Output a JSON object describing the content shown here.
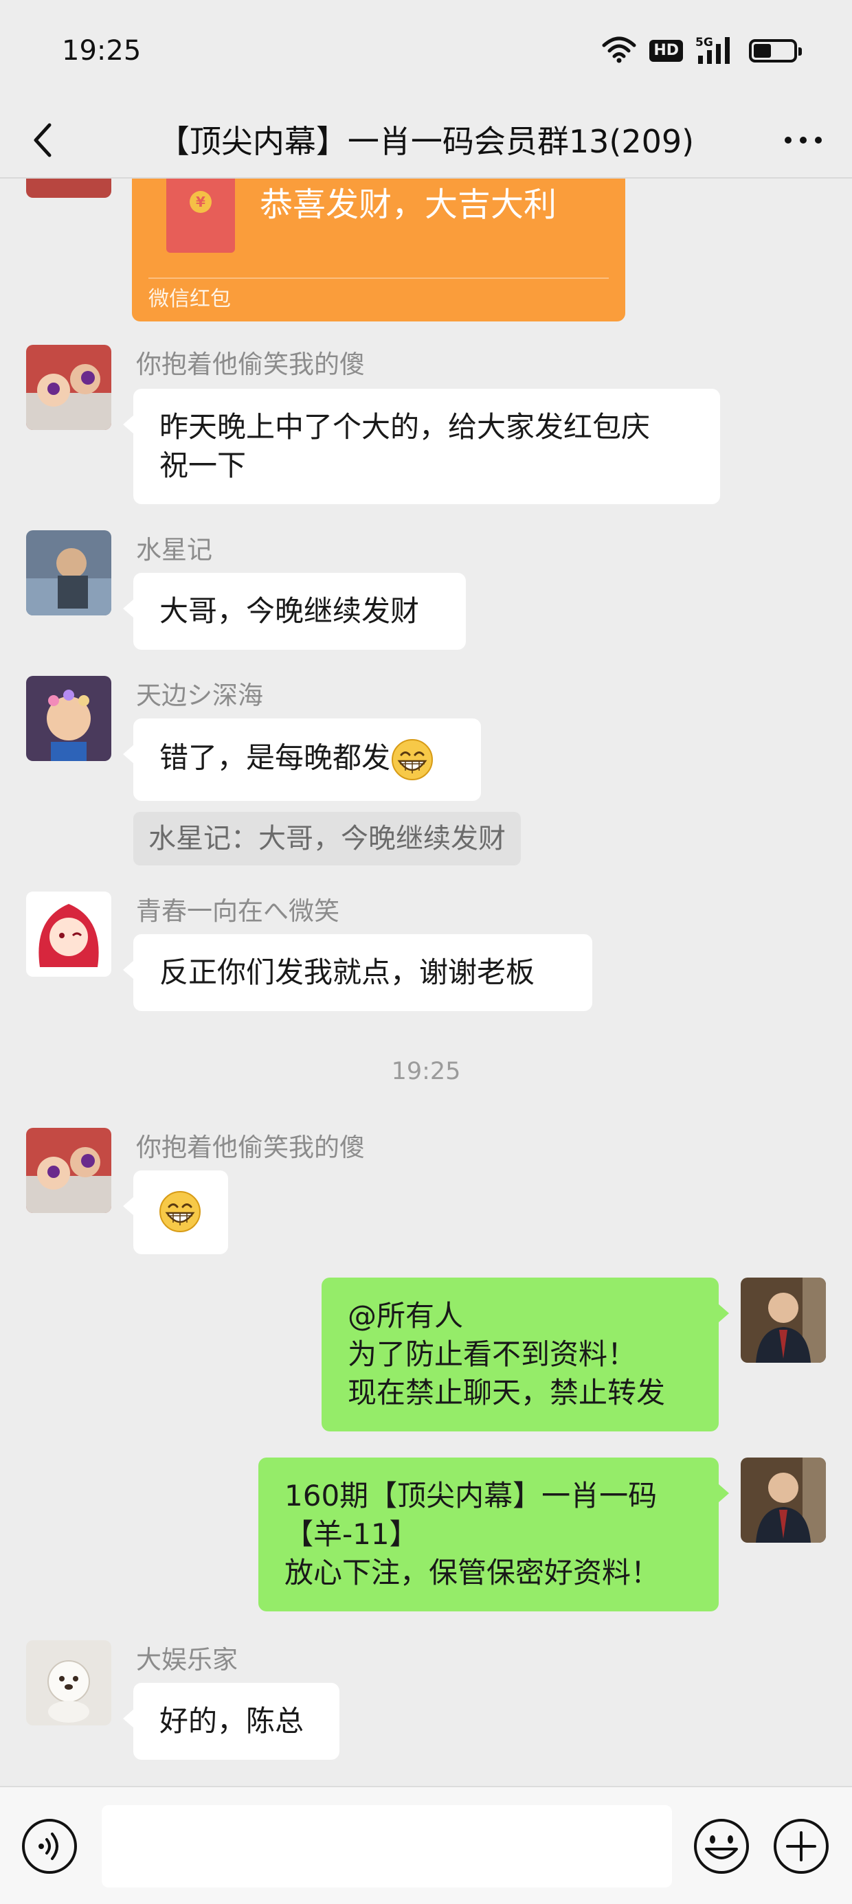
{
  "status_bar": {
    "time": "19:25",
    "hd_badge": "HD",
    "network": "5G",
    "battery_level": 0.45
  },
  "nav": {
    "title": "【顶尖内幕】一肖一码会员群13(209)"
  },
  "red_packet": {
    "greeting": "恭喜发财，大吉大利",
    "label": "微信红包",
    "coin_symbol": "¥",
    "color": "#fa9d3b"
  },
  "messages": [
    {
      "sender": "你抱着他偷笑我的傻",
      "lines": [
        "昨天晚上中了个大的，给大家发红包庆",
        "祝一下"
      ]
    },
    {
      "sender": "水星记",
      "lines": [
        "大哥，今晚继续发财"
      ]
    },
    {
      "sender": "天边シ深海",
      "lines": [
        "错了，是每晚都发"
      ],
      "emoji": "grinning-face",
      "quote": "水星记：大哥，今晚继续发财"
    },
    {
      "sender": "青春一向在へ微笑",
      "lines": [
        "反正你们发我就点，谢谢老板"
      ]
    },
    {
      "sender": "你抱着他偷笑我的傻",
      "emoji": "grinning-face"
    },
    {
      "sender": "",
      "lines": [
        "@所有人",
        "为了防止看不到资料！",
        "现在禁止聊天，禁止转发"
      ]
    },
    {
      "sender": "",
      "lines": [
        "160期【顶尖内幕】一肖一码",
        "【羊-11】",
        "放心下注，保管保密好资料！"
      ]
    },
    {
      "sender": "大娱乐家",
      "lines": [
        "好的，陈总"
      ]
    }
  ],
  "time_divider": "19:25",
  "input": {
    "placeholder": ""
  },
  "colors": {
    "background": "#ededed",
    "outgoing_bubble": "#95ec69",
    "incoming_bubble": "#ffffff",
    "sender_name": "#8c8c8c"
  }
}
